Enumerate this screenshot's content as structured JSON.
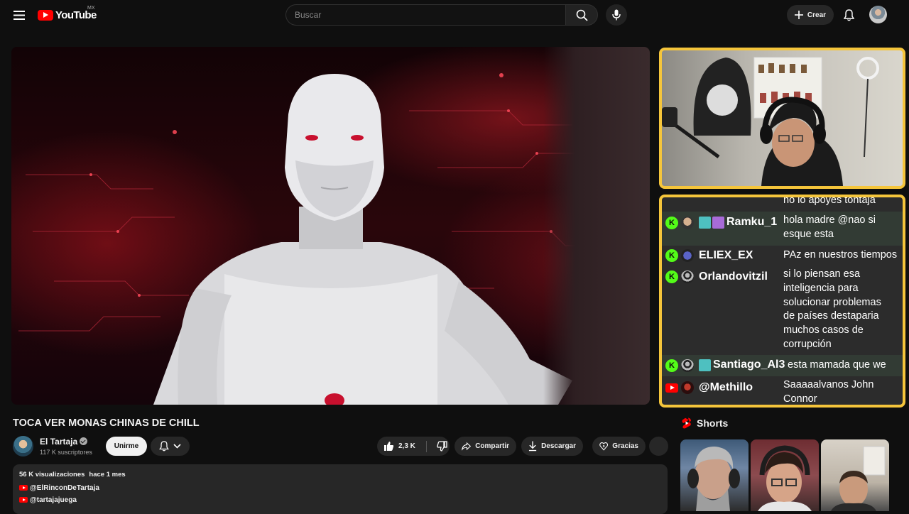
{
  "header": {
    "logo_text": "YouTube",
    "country_code": "MX",
    "search_placeholder": "Buscar",
    "create_label": "Crear"
  },
  "video": {
    "title": "TOCA VER MONAS CHINAS DE CHILL"
  },
  "channel": {
    "name": "El Tartaja",
    "subscribers": "117 K suscriptores",
    "join_label": "Unirme"
  },
  "actions": {
    "likes": "2,3 K",
    "share": "Compartir",
    "download": "Descargar",
    "thanks": "Gracias"
  },
  "description": {
    "views": "56 K visualizaciones",
    "date": "hace 1 mes",
    "links": [
      "@ElRinconDeTartaja",
      "@tartajajuega"
    ]
  },
  "chat": {
    "top_partial": "no lo apoyes tontaja",
    "messages": [
      {
        "platform": "kick",
        "user": "Ramku_1",
        "lines": [
          "hola madre @nao si",
          "esque esta"
        ]
      },
      {
        "platform": "kick",
        "user": "ELIEX_EX",
        "lines": [
          "PAz en nuestros tiempos"
        ]
      },
      {
        "platform": "kick",
        "user": "Orlandovitzil",
        "lines": [
          "si lo piensan esa",
          "inteligencia para",
          "solucionar problemas",
          "de países destaparia",
          "muchos casos de",
          "corrupción"
        ]
      },
      {
        "platform": "kick",
        "user": "Santiago_Al3",
        "lines": [
          "esta mamada que we"
        ]
      },
      {
        "platform": "youtube",
        "user": "@Methillo",
        "lines": [
          "Saaaaalvanos John",
          "Connor"
        ]
      }
    ]
  },
  "shorts": {
    "heading": "Shorts"
  },
  "colors": {
    "background": "#0f0f0f",
    "accent_red": "#ff0000",
    "overlay_frame": "#f5c53b",
    "kick_green": "#53fc18"
  }
}
